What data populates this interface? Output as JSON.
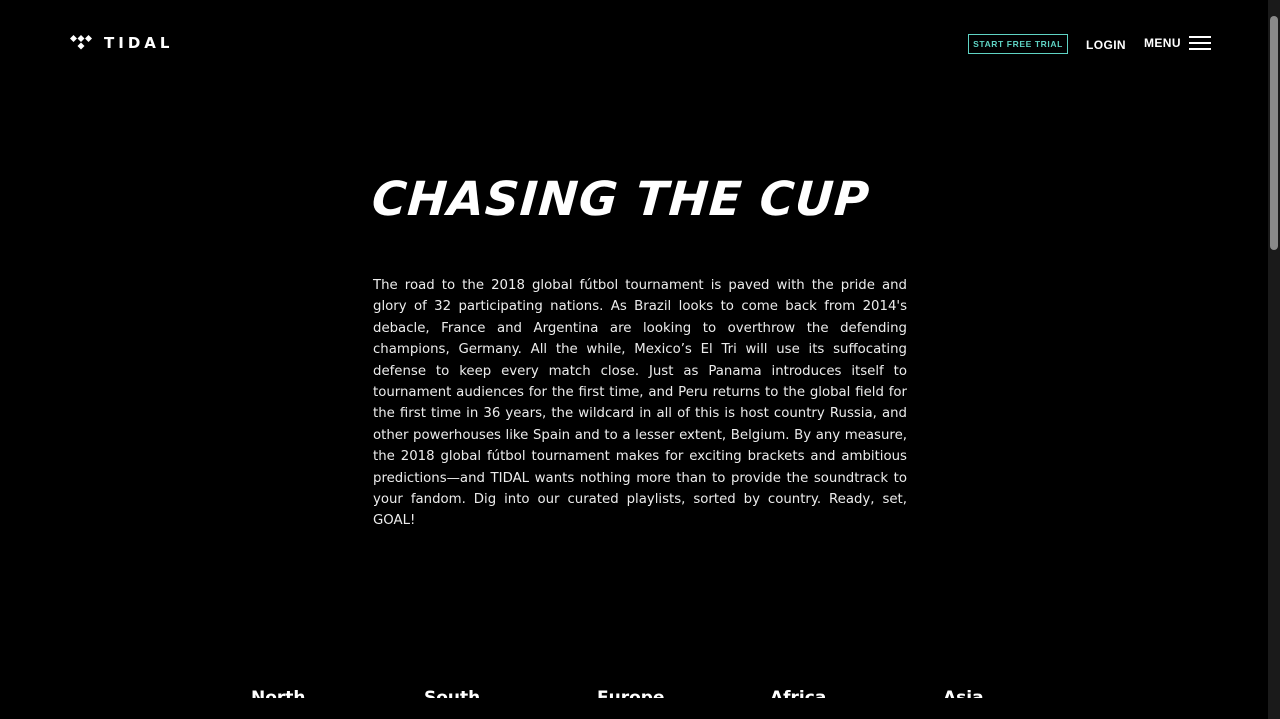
{
  "header": {
    "brand": "TIDAL",
    "logo_icon": "tidal-logo-icon",
    "trial_button": "START FREE TRIAL",
    "login_link": "LOGIN",
    "menu_label": "MENU",
    "menu_icon": "hamburger-icon",
    "accent_color": "#5fd3c4"
  },
  "main": {
    "title": "CHASING THE CUP",
    "intro": "The road to the 2018 global fútbol tournament is paved with the pride and glory of 32 participating nations. As Brazil looks to come back from 2014's debacle, France and Argentina are looking to overthrow the defending champions, Germany. All the while, Mexico’s El Tri will use its suffocating defense to keep every match close. Just as Panama introduces itself to tournament audiences for the first time, and Peru returns to the global field for the first time in 36 years, the wildcard in all of this is host country Russia, and other powerhouses like Spain and to a lesser extent, Belgium. By any measure, the 2018 global fútbol tournament makes for exciting brackets and ambitious predictions—and TIDAL wants nothing more than to provide the soundtrack to your fandom. Dig into our curated playlists, sorted by country. Ready, set, GOAL!"
  },
  "regions": [
    {
      "label": "North"
    },
    {
      "label": "South"
    },
    {
      "label": "Europe"
    },
    {
      "label": "Africa"
    },
    {
      "label": "Asia"
    }
  ]
}
